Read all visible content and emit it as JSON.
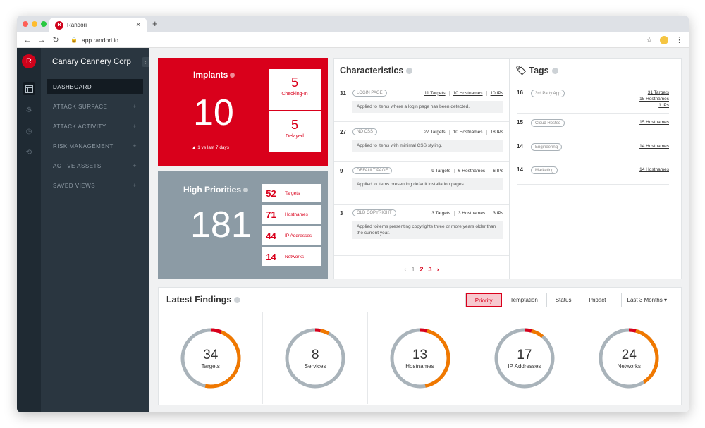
{
  "browser": {
    "tab_title": "Randori",
    "tab_favicon": "R",
    "url": "app.randori.io"
  },
  "colors": {
    "brand": "#d9001b",
    "gray_card": "#8c9ba5",
    "sidebar": "#2a3640",
    "ring_gray": "#a9b3ba",
    "ring_orange": "#f07800"
  },
  "sidebar": {
    "logo": "R",
    "company": "Canary Cannery Corp",
    "items": [
      {
        "label": "DASHBOARD"
      },
      {
        "label": "ATTACK SURFACE",
        "plus": "+"
      },
      {
        "label": "ATTACK ACTIVITY",
        "plus": "+"
      },
      {
        "label": "RISK MANAGEMENT",
        "plus": "+"
      },
      {
        "label": "ACTIVE ASSETS",
        "plus": "+"
      },
      {
        "label": "SAVED VIEWS",
        "plus": "+"
      }
    ]
  },
  "implants": {
    "title": "Implants",
    "value": "10",
    "subtext": "1 vs last 7 days",
    "boxes": [
      {
        "value": "5",
        "label": "Checking-In"
      },
      {
        "value": "5",
        "label": "Delayed"
      }
    ]
  },
  "high_priorities": {
    "title": "High Priorities",
    "value": "181",
    "rows": [
      {
        "value": "52",
        "label": "Targets"
      },
      {
        "value": "71",
        "label": "Hostnames"
      },
      {
        "value": "44",
        "label": "IP Addresses"
      },
      {
        "value": "14",
        "label": "Networks"
      }
    ]
  },
  "characteristics": {
    "title": "Characteristics",
    "items": [
      {
        "count": "31",
        "tag": "LOGIN PAGE",
        "targets": "11 Targets",
        "hostnames": "10 Hostnames",
        "ips": "10 IPs",
        "desc": "Applied to items where a login page has been detected."
      },
      {
        "count": "27",
        "tag": "NO CSS",
        "targets": "27 Targets",
        "hostnames": "10 Hostnames",
        "ips": "18 IPs",
        "desc": "Applied to items with minimal CSS styling."
      },
      {
        "count": "9",
        "tag": "DEFAULT PAGE",
        "targets": "9 Targets",
        "hostnames": "6 Hostnames",
        "ips": "6 IPs",
        "desc": "Applied to items presenting default installation pages."
      },
      {
        "count": "3",
        "tag": "OLD COPYRIGHT",
        "targets": "3 Targets",
        "hostnames": "3 Hostnames",
        "ips": "3 IPs",
        "desc": "Applied toitems presenting copyrights three or more years older than the current year."
      }
    ],
    "pager": {
      "prev": "‹",
      "p1": "1",
      "p2": "2",
      "p3": "3",
      "next": "›"
    }
  },
  "tags": {
    "title": "Tags",
    "items": [
      {
        "count": "16",
        "tag": "3rd Party App",
        "links": [
          "31 Targets",
          "15 Hostnames",
          "1 IPs"
        ]
      },
      {
        "count": "15",
        "tag": "Cloud Hosted",
        "links": [
          "15 Hostnames"
        ]
      },
      {
        "count": "14",
        "tag": "Engineering",
        "links": [
          "14 Hostnames"
        ]
      },
      {
        "count": "14",
        "tag": "Marketing",
        "links": [
          "14 Hostnames"
        ]
      }
    ]
  },
  "findings": {
    "title": "Latest Findings",
    "tabs": [
      "Priority",
      "Temptation",
      "Status",
      "Impact"
    ],
    "range": "Last 3 Months ▾",
    "donuts": [
      {
        "value": "34",
        "label": "Targets",
        "red": 0.06,
        "orange": 0.47
      },
      {
        "value": "8",
        "label": "Services",
        "red": 0.03,
        "orange": 0.05
      },
      {
        "value": "13",
        "label": "Hostnames",
        "red": 0.04,
        "orange": 0.43
      },
      {
        "value": "17",
        "label": "IP Addresses",
        "red": 0.04,
        "orange": 0.07
      },
      {
        "value": "24",
        "label": "Networks",
        "red": 0.04,
        "orange": 0.37
      }
    ]
  }
}
